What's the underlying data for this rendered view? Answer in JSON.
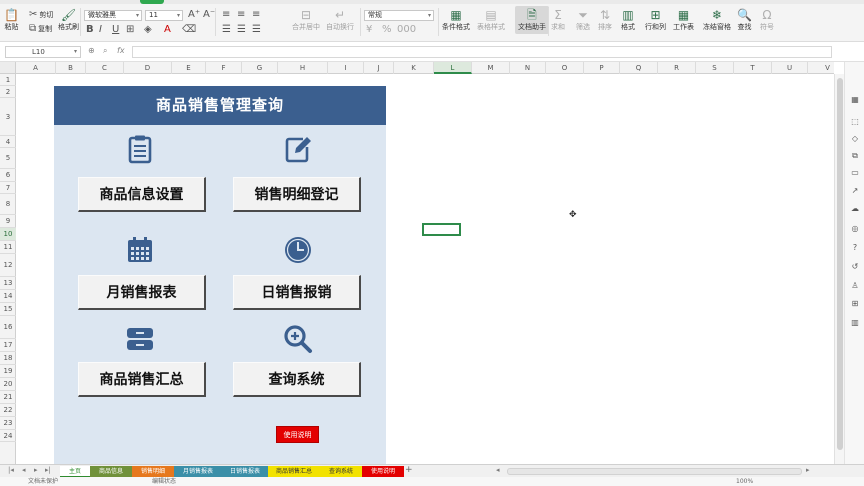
{
  "ribbon": {
    "paste": "粘贴",
    "cut": "剪切",
    "copy": "复制",
    "format_painter": "格式刷",
    "font_name": "微软雅黑",
    "font_size": "11",
    "number_format": "常规",
    "merge": "合并居中",
    "wrap": "自动换行",
    "conditional_format": "条件格式",
    "table_style": "表格样式",
    "doc_helper": "文档助手",
    "sum": "求和",
    "filter": "筛选",
    "sort": "排序",
    "format": "格式",
    "rows_cols": "行和列",
    "worksheet": "工作表",
    "freeze": "冻结窗格",
    "find": "查找",
    "symbol": "符号"
  },
  "formula_bar": {
    "name_box": "L10",
    "fx": "fx",
    "content": ""
  },
  "columns": [
    "A",
    "B",
    "C",
    "D",
    "E",
    "F",
    "G",
    "H",
    "I",
    "J",
    "K",
    "L",
    "M",
    "N",
    "O",
    "P",
    "Q",
    "R",
    "S",
    "T",
    "U",
    "V"
  ],
  "rows": [
    "1",
    "2",
    "3",
    "4",
    "5",
    "6",
    "7",
    "8",
    "9",
    "10",
    "11",
    "12",
    "13",
    "14",
    "15",
    "16",
    "17",
    "18",
    "19",
    "20",
    "21",
    "22",
    "23",
    "24"
  ],
  "panel": {
    "title": "商品销售管理查询",
    "buttons": [
      {
        "label": "商品信息设置",
        "icon": "clipboard-icon"
      },
      {
        "label": "销售明细登记",
        "icon": "edit-icon"
      },
      {
        "label": "月销售报表",
        "icon": "calendar-icon"
      },
      {
        "label": "日销售报销",
        "icon": "clock-icon"
      },
      {
        "label": "商品销售汇总",
        "icon": "archive-icon"
      },
      {
        "label": "查询系统",
        "icon": "search-icon"
      }
    ],
    "help_button": "使用说明",
    "icon_color": "#3b5f8f"
  },
  "sheet_tabs": [
    {
      "label": "主页",
      "color": "#ffffff",
      "text_color": "#2e8b2e",
      "active": true
    },
    {
      "label": "商品信息",
      "color": "#70913a",
      "text_color": "#ffffff"
    },
    {
      "label": "销售明细",
      "color": "#e6781e",
      "text_color": "#ffffff"
    },
    {
      "label": "月销售报表",
      "color": "#3b8fa8",
      "text_color": "#ffffff"
    },
    {
      "label": "日销售报表",
      "color": "#3b8fa8",
      "text_color": "#ffffff"
    },
    {
      "label": "商品销售汇总",
      "color": "#f2e200",
      "text_color": "#333333"
    },
    {
      "label": "查询系统",
      "color": "#f2e200",
      "text_color": "#333333"
    },
    {
      "label": "使用说明",
      "color": "#e30000",
      "text_color": "#ffffff"
    }
  ],
  "status": {
    "left": "文档未保护",
    "middle": "编辑状态",
    "zoom": "100%"
  }
}
